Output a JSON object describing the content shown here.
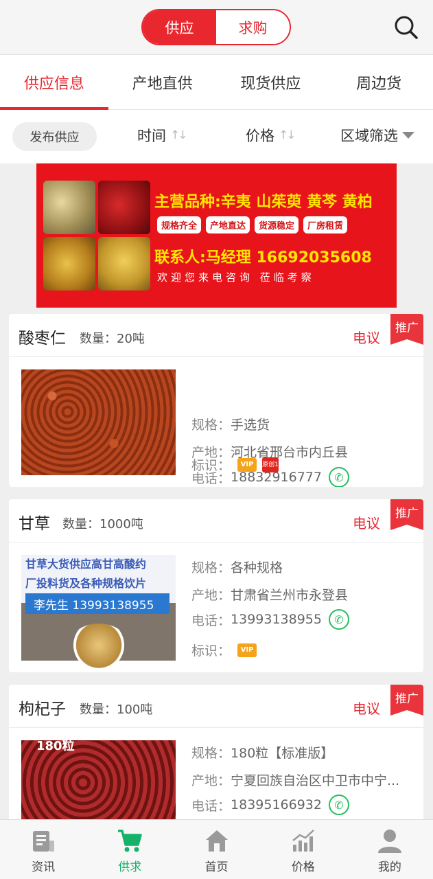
{
  "header": {
    "segment": {
      "supply": "供应",
      "demand": "求购",
      "selected": "供应"
    },
    "search_icon": "search-icon"
  },
  "tabs": [
    {
      "label": "供应信息",
      "active": true
    },
    {
      "label": "产地直供",
      "active": false
    },
    {
      "label": "现货供应",
      "active": false
    },
    {
      "label": "周边货",
      "active": false
    }
  ],
  "filters": {
    "publish": "发布供应",
    "time": "时间",
    "price": "价格",
    "region": "区域筛选"
  },
  "banner": {
    "title": "主营品种:辛夷 山茱萸 黄芩 黄柏",
    "tags": [
      "规格齐全",
      "产地直达",
      "货源稳定",
      "厂房租赁"
    ],
    "contact": "联系人:马经理 16692035608",
    "welcome": "欢迎您来电咨询   莅临考察"
  },
  "labels": {
    "spec": "规格：",
    "origin": "产地：",
    "phone": "电话：",
    "mark": "标识：",
    "promo": "推广",
    "price": "电议"
  },
  "listings": [
    {
      "name": "酸枣仁",
      "quantity": "数量：20吨",
      "spec": "手选货",
      "origin": "河北省邢台市内丘县",
      "phone": "18832916777",
      "badges": [
        "VIP",
        "原创1"
      ]
    },
    {
      "name": "甘草",
      "quantity": "数量：1000吨",
      "spec": "各种规格",
      "origin": "甘肃省兰州市永登县",
      "phone": "13993138955",
      "badges": [
        "VIP"
      ],
      "image_text": [
        "甘草大货供应高甘高酸约",
        "厂投料货及各种规格饮片",
        "李先生 13993138955"
      ]
    },
    {
      "name": "枸杞子",
      "quantity": "数量：100吨",
      "spec": "180粒【标准版】",
      "origin": "宁夏回族自治区中卫市中宁...",
      "phone": "18395166932",
      "image_text": "180粒"
    }
  ],
  "bottom_nav": [
    {
      "label": "资讯",
      "icon": "news-icon",
      "active": false
    },
    {
      "label": "供求",
      "icon": "cart-icon",
      "active": true
    },
    {
      "label": "首页",
      "icon": "home-icon",
      "active": false
    },
    {
      "label": "价格",
      "icon": "price-chart-icon",
      "active": false
    },
    {
      "label": "我的",
      "icon": "user-icon",
      "active": false
    }
  ],
  "colors": {
    "accent": "#e8272f",
    "nav_active": "#17b26a",
    "phone_green": "#20c05a"
  }
}
